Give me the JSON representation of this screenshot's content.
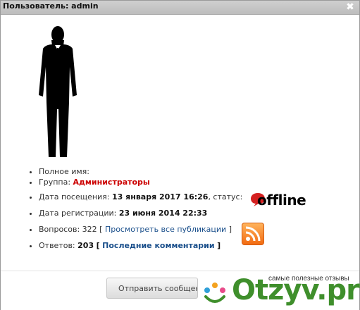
{
  "window": {
    "title": "Пользователь: admin",
    "close_glyph": "✖"
  },
  "profile": {
    "full_name_label": "Полное имя:",
    "group_label": "Группа:",
    "group_value": "Администраторы",
    "last_visit_label": "Дата посещения:",
    "last_visit_value": "13 января 2017 16:26",
    "status_label": ", статус:",
    "status_value": "offline",
    "registered_label": "Дата регистрации:",
    "registered_value": "23 июня 2014 22:33",
    "questions_label": "Вопросов: 322",
    "questions_link": "Просмотреть все публикации",
    "answers_label": "Ответов:",
    "answers_value": "203",
    "answers_link": "Последние комментарии",
    "bracket_open": "[",
    "bracket_close": "]"
  },
  "icons": {
    "avatar": "user-silhouette",
    "status": "speech-bubble-icon",
    "rss": "rss-icon"
  },
  "footer": {
    "send_button": "Отправить сообщение"
  },
  "watermark": {
    "caption": "самые полезные отзывы",
    "brand": "Otzyv.pro"
  },
  "colors": {
    "group": "#cc0000",
    "link": "#1a4f8b",
    "brand": "#3f8f2c",
    "rss": "#f26b12"
  }
}
